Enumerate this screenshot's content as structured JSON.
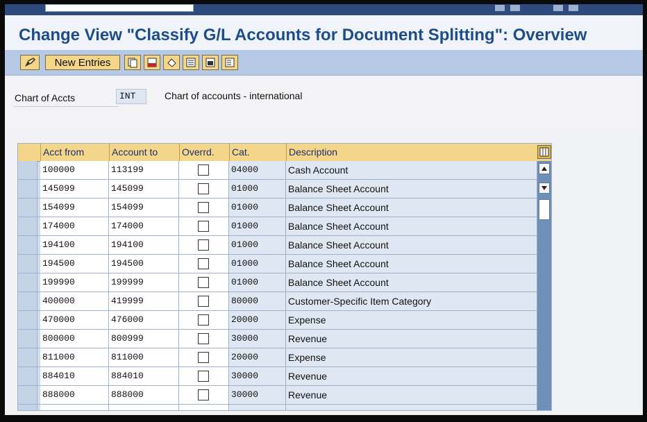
{
  "header": {
    "title": "Change View \"Classify G/L Accounts for Document Splitting\": Overview"
  },
  "toolbar": {
    "new_entries_label": "New Entries"
  },
  "selection": {
    "label": "Chart of Accts",
    "value": "INT",
    "description": "Chart of accounts - international"
  },
  "table": {
    "columns": [
      "Acct from",
      "Account to",
      "Overrd.",
      "Cat.",
      "Description"
    ],
    "rows": [
      {
        "from": "100000",
        "to": "113199",
        "cat": "04000",
        "desc": "Cash Account"
      },
      {
        "from": "145099",
        "to": "145099",
        "cat": "01000",
        "desc": "Balance Sheet Account"
      },
      {
        "from": "154099",
        "to": "154099",
        "cat": "01000",
        "desc": "Balance Sheet Account"
      },
      {
        "from": "174000",
        "to": "174000",
        "cat": "01000",
        "desc": "Balance Sheet Account"
      },
      {
        "from": "194100",
        "to": "194100",
        "cat": "01000",
        "desc": "Balance Sheet Account"
      },
      {
        "from": "194500",
        "to": "194500",
        "cat": "01000",
        "desc": "Balance Sheet Account"
      },
      {
        "from": "199990",
        "to": "199999",
        "cat": "01000",
        "desc": "Balance Sheet Account"
      },
      {
        "from": "400000",
        "to": "419999",
        "cat": "80000",
        "desc": "Customer-Specific Item Category"
      },
      {
        "from": "470000",
        "to": "476000",
        "cat": "20000",
        "desc": "Expense"
      },
      {
        "from": "800000",
        "to": "800999",
        "cat": "30000",
        "desc": "Revenue"
      },
      {
        "from": "811000",
        "to": "811000",
        "cat": "20000",
        "desc": "Expense"
      },
      {
        "from": "884010",
        "to": "884010",
        "cat": "30000",
        "desc": "Revenue"
      },
      {
        "from": "888000",
        "to": "888000",
        "cat": "30000",
        "desc": "Revenue"
      }
    ]
  },
  "icons": [
    "edit-icon",
    "copy-icon",
    "delete-icon",
    "undo-icon",
    "select-all-icon",
    "select-block-icon",
    "deselect-all-icon",
    "column-settings-icon",
    "scroll-up-icon",
    "scroll-down-icon"
  ],
  "colors": {
    "title": "#1c4d88",
    "toolbar": "#b5c9e6",
    "button": "#f3d68a",
    "table": "#cfdceb"
  }
}
